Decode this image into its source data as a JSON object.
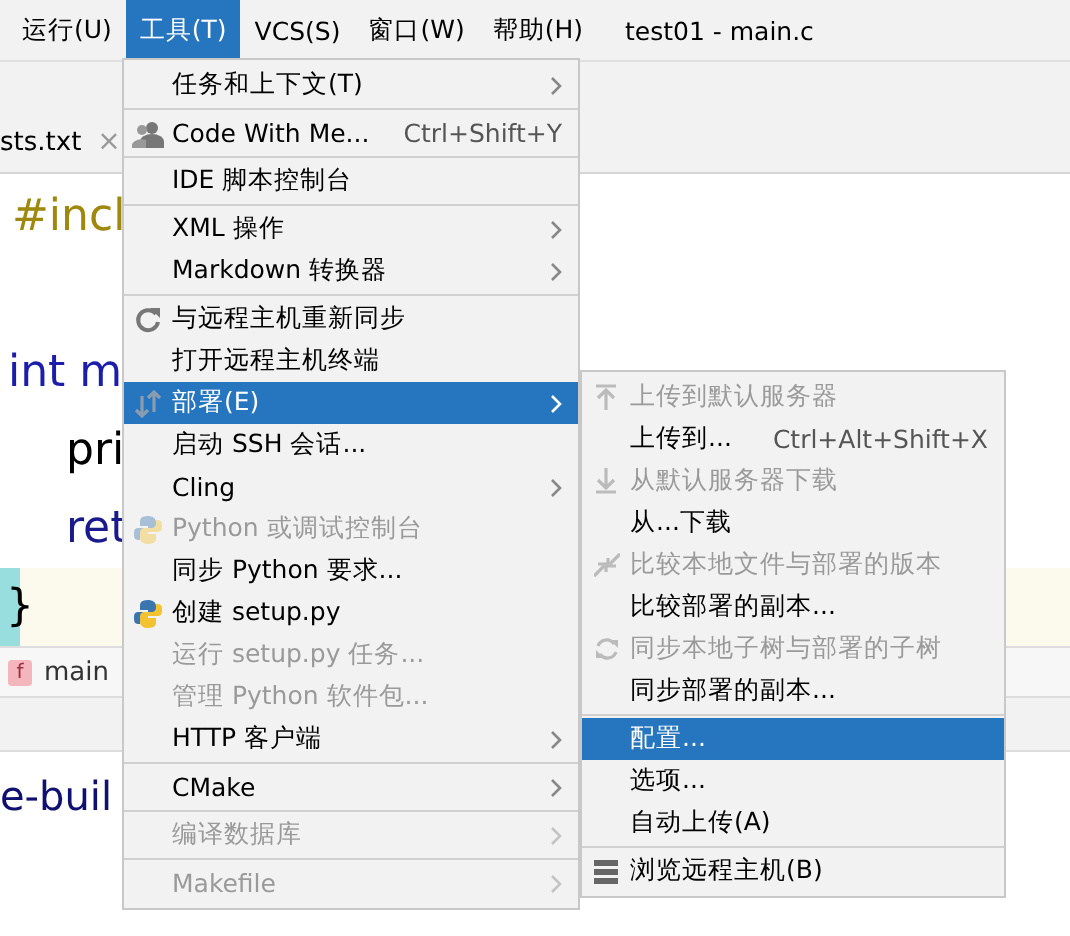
{
  "menubar": [
    {
      "label": "运行(U)",
      "selected": false
    },
    {
      "label": "工具(T)",
      "selected": true
    },
    {
      "label": "VCS(S)",
      "selected": false
    },
    {
      "label": "窗口(W)",
      "selected": false
    },
    {
      "label": "帮助(H)",
      "selected": false
    }
  ],
  "window_title": "test01 - main.c",
  "editor_tab": {
    "label": "sts.txt",
    "close": "×"
  },
  "code_lines": [
    {
      "kind": "directive",
      "text": "#incl",
      "current": false
    },
    {
      "kind": "blank",
      "current": false
    },
    {
      "kind": "declaration",
      "text": "int m",
      "current": false
    },
    {
      "kind": "call",
      "text": "pri",
      "current": false
    },
    {
      "kind": "keyword",
      "text": "ret",
      "current": false
    },
    {
      "kind": "brace",
      "text": "}",
      "current": true
    }
  ],
  "breadcrumb": {
    "badge": "f",
    "label": "main"
  },
  "build_panel": {
    "text": "e-buil"
  },
  "tools_menu": [
    {
      "kind": "item",
      "label": "任务和上下文(T)",
      "submenu": true,
      "disabled": false,
      "selected": false
    },
    {
      "kind": "separator"
    },
    {
      "kind": "item",
      "label": "Code With Me...",
      "shortcut": "Ctrl+Shift+Y",
      "submenu": false,
      "disabled": false,
      "selected": false
    },
    {
      "kind": "separator"
    },
    {
      "kind": "item",
      "label": "IDE 脚本控制台",
      "submenu": false,
      "disabled": false,
      "selected": false
    },
    {
      "kind": "separator"
    },
    {
      "kind": "item",
      "label": "XML 操作",
      "submenu": true,
      "disabled": false,
      "selected": false
    },
    {
      "kind": "item",
      "label": "Markdown 转换器",
      "submenu": true,
      "disabled": false,
      "selected": false
    },
    {
      "kind": "separator"
    },
    {
      "kind": "item",
      "label": "与远程主机重新同步",
      "submenu": false,
      "disabled": false,
      "selected": false
    },
    {
      "kind": "item",
      "label": "打开远程主机终端",
      "submenu": false,
      "disabled": false,
      "selected": false
    },
    {
      "kind": "item",
      "label": "部署(E)",
      "submenu": true,
      "disabled": false,
      "selected": true
    },
    {
      "kind": "item",
      "label": "启动 SSH 会话...",
      "submenu": false,
      "disabled": false,
      "selected": false
    },
    {
      "kind": "item",
      "label": "Cling",
      "submenu": true,
      "disabled": false,
      "selected": false
    },
    {
      "kind": "item",
      "label": "Python 或调试控制台",
      "submenu": false,
      "disabled": true,
      "selected": false
    },
    {
      "kind": "item",
      "label": "同步 Python 要求...",
      "submenu": false,
      "disabled": false,
      "selected": false
    },
    {
      "kind": "item",
      "label": "创建 setup.py",
      "submenu": false,
      "disabled": false,
      "selected": false
    },
    {
      "kind": "item",
      "label": "运行 setup.py 任务...",
      "submenu": false,
      "disabled": true,
      "selected": false
    },
    {
      "kind": "item",
      "label": "管理 Python 软件包...",
      "submenu": false,
      "disabled": true,
      "selected": false
    },
    {
      "kind": "item",
      "label": "HTTP 客户端",
      "submenu": true,
      "disabled": false,
      "selected": false
    },
    {
      "kind": "separator"
    },
    {
      "kind": "item",
      "label": "CMake",
      "submenu": true,
      "disabled": false,
      "selected": false
    },
    {
      "kind": "separator"
    },
    {
      "kind": "item",
      "label": "编译数据库",
      "submenu": true,
      "disabled": true,
      "selected": false
    },
    {
      "kind": "separator"
    },
    {
      "kind": "item",
      "label": "Makefile",
      "submenu": true,
      "disabled": true,
      "selected": false
    }
  ],
  "deploy_submenu": [
    {
      "kind": "item",
      "label": "上传到默认服务器",
      "disabled": true,
      "selected": false
    },
    {
      "kind": "item",
      "label": "上传到...",
      "shortcut": "Ctrl+Alt+Shift+X",
      "disabled": false,
      "selected": false
    },
    {
      "kind": "item",
      "label": "从默认服务器下载",
      "disabled": true,
      "selected": false
    },
    {
      "kind": "item",
      "label": "从...下载",
      "disabled": false,
      "selected": false
    },
    {
      "kind": "item",
      "label": "比较本地文件与部署的版本",
      "disabled": true,
      "selected": false
    },
    {
      "kind": "item",
      "label": "比较部署的副本...",
      "disabled": false,
      "selected": false
    },
    {
      "kind": "item",
      "label": "同步本地子树与部署的子树",
      "disabled": true,
      "selected": false
    },
    {
      "kind": "item",
      "label": "同步部署的副本...",
      "disabled": false,
      "selected": false
    },
    {
      "kind": "separator"
    },
    {
      "kind": "item",
      "label": "配置...",
      "disabled": false,
      "selected": true
    },
    {
      "kind": "item",
      "label": "选项...",
      "disabled": false,
      "selected": false
    },
    {
      "kind": "item",
      "label": "自动上传(A)",
      "disabled": false,
      "selected": false
    },
    {
      "kind": "separator"
    },
    {
      "kind": "item",
      "label": "浏览远程主机(B)",
      "disabled": false,
      "selected": false
    }
  ]
}
